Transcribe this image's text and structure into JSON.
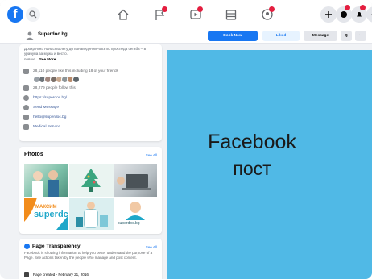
{
  "page": {
    "name": "Superdoc.bg",
    "buttons": {
      "book": "Book Now",
      "liked": "Liked",
      "message": "Message",
      "search": "Q",
      "more": "···"
    }
  },
  "about": {
    "description": "Дрохр ноко нанасявалегу до вонаведенни чакз по проследа сегаба – в урабуна за мужа и весто.",
    "more_prefix": "повше...",
    "more_label": "See More",
    "likes_text": "28,110 people like this including 18 of your friends",
    "follows_text": "28,279 people follow this",
    "website": "https://superdoc.bg/",
    "send_message": "Send Message",
    "email": "hello@superdoc.bg",
    "category": "Medical Service"
  },
  "photos": {
    "title": "Photos",
    "see_all": "See All",
    "brand_top": "МАКСИМ",
    "brand_main": "superdc",
    "caption": "superdoc.bg"
  },
  "transparency": {
    "title": "Page Transparency",
    "see_all": "See All",
    "text": "Facebook is showing information to help you better understand the purpose of a Page. See actions taken by the people who manage and post content.",
    "created": "Page created - February 21, 2016"
  },
  "overlay": {
    "line1": "Facebook",
    "line2": "пост"
  },
  "colors": {
    "accent": "#1877f2",
    "overlay": "#50b9e6",
    "badge": "#e41e3f"
  }
}
